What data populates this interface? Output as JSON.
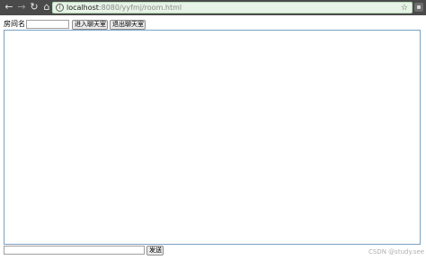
{
  "browser": {
    "url_host": "localhost",
    "url_path": ":8080/yyfmj/room.html",
    "icons": {
      "back": "back-arrow-icon",
      "forward": "forward-arrow-icon",
      "reload": "reload-icon",
      "home": "home-icon",
      "info": "info-icon",
      "bookmark": "star-icon",
      "extension": "extension-icon"
    }
  },
  "room": {
    "label": "房间名",
    "input_value": "",
    "enter_button": "进入聊天室",
    "exit_button": "退出聊天室"
  },
  "chat": {
    "messages": []
  },
  "composer": {
    "input_value": "",
    "send_button": "发送"
  },
  "watermark": "CSDN @study.see",
  "colors": {
    "browser_bar": "#4a4a4a",
    "address_bg": "#e6f3e6",
    "chat_border": "#7aa0c0"
  }
}
